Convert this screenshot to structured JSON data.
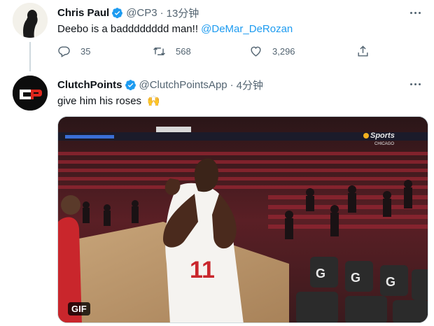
{
  "tweet1": {
    "display_name": "Chris Paul",
    "handle": "@CP3",
    "separator": "·",
    "time": "13分钟",
    "text": "Deebo is a badddddddd man!! ",
    "mention": "@DeMar_DeRozan",
    "reply_count": "35",
    "retweet_count": "568",
    "like_count": "3,296"
  },
  "tweet2": {
    "display_name": "ClutchPoints",
    "handle": "@ClutchPointsApp",
    "separator": "·",
    "time": "4分钟",
    "avatar_text": "CP",
    "text": "give him his roses ",
    "emoji": "🙌",
    "media": {
      "badge": "GIF",
      "arena_logo": "Sports",
      "arena_logo_sub": "CHICAGO",
      "jersey_number": "11"
    }
  },
  "colors": {
    "accent": "#1d9bf0",
    "secondary_text": "#536471",
    "clutch_red": "#e0261c"
  }
}
